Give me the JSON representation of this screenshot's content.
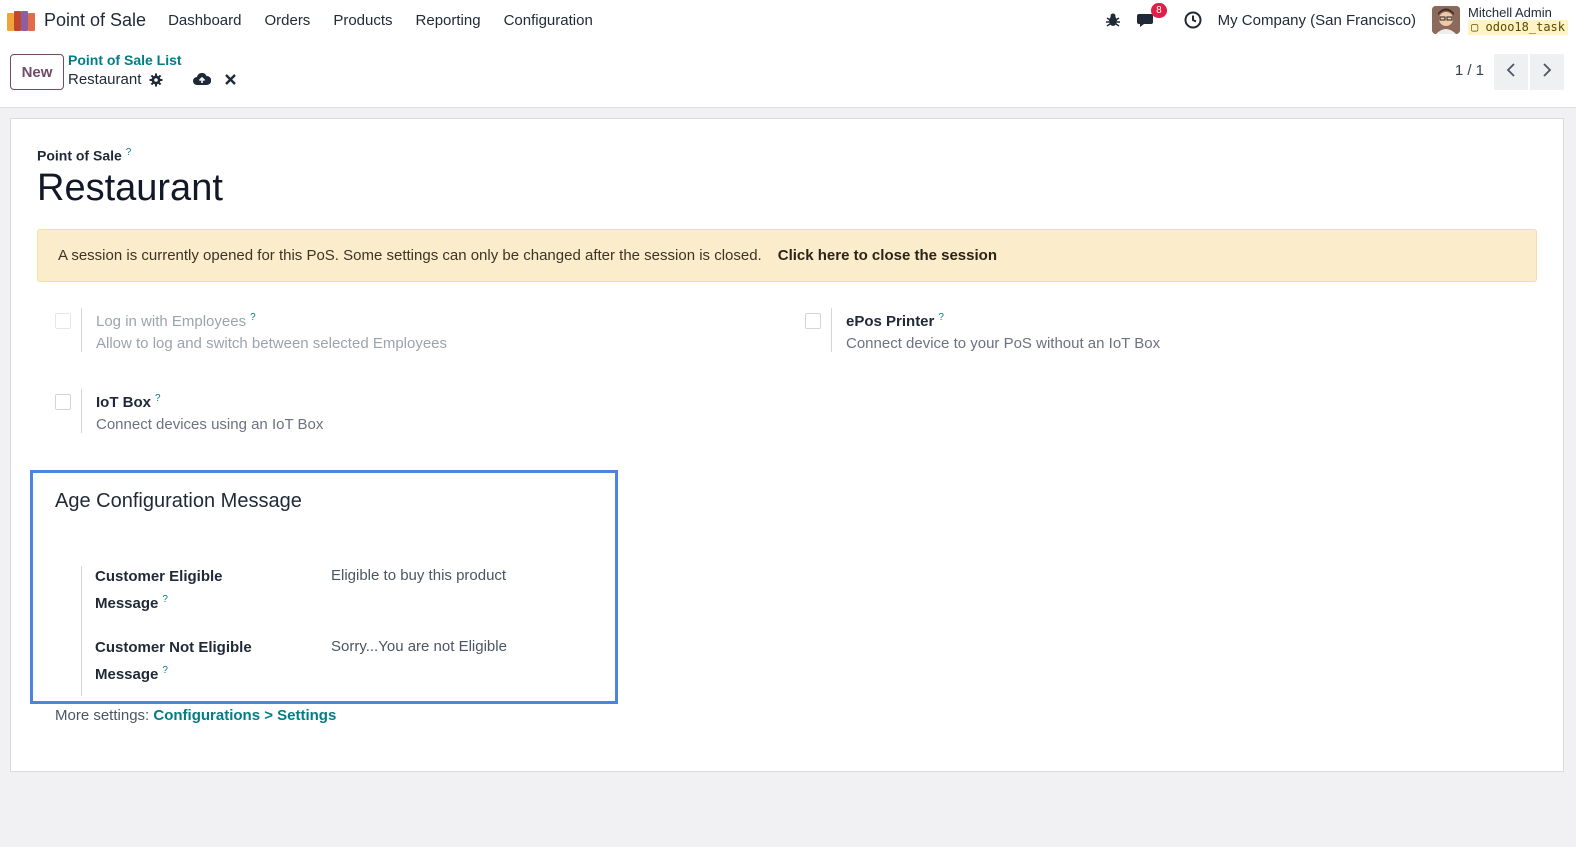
{
  "navbar": {
    "app_name": "Point of Sale",
    "menu": [
      "Dashboard",
      "Orders",
      "Products",
      "Reporting",
      "Configuration"
    ],
    "message_count": "8",
    "company": "My Company (San Francisco)",
    "user_name": "Mitchell Admin",
    "database": "odoo18_task"
  },
  "controlbar": {
    "new_label": "New",
    "breadcrumb_parent": "Point of Sale List",
    "breadcrumb_current": "Restaurant",
    "pager": "1 / 1"
  },
  "form": {
    "field_label": "Point of Sale",
    "help_mark": "?",
    "record_name": "Restaurant",
    "alert_text": "A session is currently opened for this PoS. Some settings can only be changed after the session is closed.",
    "alert_link": "Click here to close the session",
    "settings": [
      {
        "title": "Log in with Employees",
        "description": "Allow to log and switch between selected Employees",
        "checked": false,
        "disabled": true
      },
      {
        "title": "ePos Printer",
        "description": "Connect device to your PoS without an IoT Box",
        "checked": false,
        "disabled": false
      },
      {
        "title": "IoT Box",
        "description": "Connect devices using an IoT Box",
        "checked": false,
        "disabled": false
      }
    ],
    "age_section": {
      "title": "Age Configuration Message",
      "eligible_label_1": "Customer Eligible",
      "eligible_label_2": "Message",
      "eligible_value": "Eligible to buy this product",
      "not_eligible_label_1": "Customer Not Eligible",
      "not_eligible_label_2": "Message",
      "not_eligible_value": "Sorry...You are not Eligible"
    },
    "more_settings_prefix": "More settings:",
    "more_settings_link": "Configurations > Settings"
  },
  "colors": {
    "brand": "#714b67",
    "link": "#017e84",
    "highlight_border": "#4a86e0",
    "alert_bg": "#fbeccb",
    "badge": "#e11d48"
  },
  "icons": [
    "app-logo-icon",
    "bug-icon",
    "chat-icon",
    "clock-icon",
    "gear-icon",
    "cloud-upload-icon",
    "close-icon",
    "chevron-left-icon",
    "chevron-right-icon",
    "database-icon"
  ]
}
